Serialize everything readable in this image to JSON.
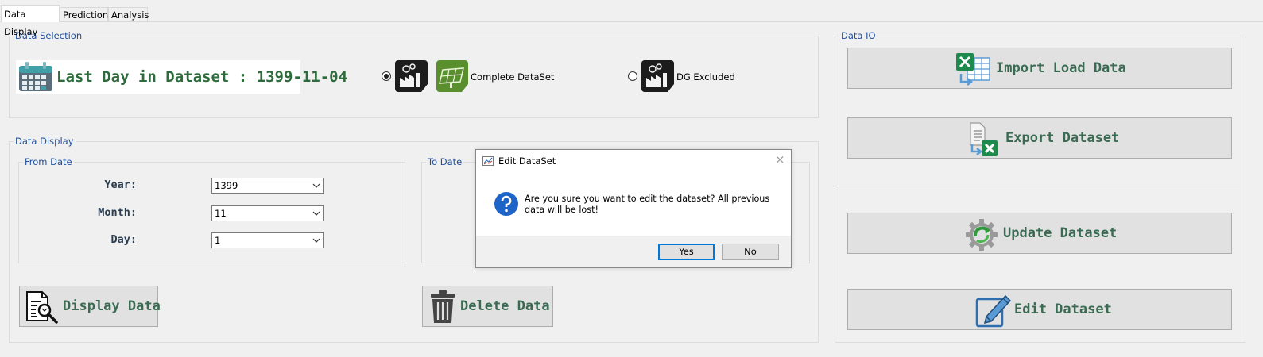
{
  "tabs": [
    {
      "label": "Data Display",
      "active": true
    },
    {
      "label": "Prediction",
      "active": false
    },
    {
      "label": "Analysis",
      "active": false
    }
  ],
  "data_selection": {
    "title": "Data Selection",
    "last_day_label": "Last Day in Dataset : 1399-11-04",
    "options": [
      {
        "label": "Complete DataSet",
        "selected": true
      },
      {
        "label": "DG Excluded",
        "selected": false
      }
    ]
  },
  "data_display": {
    "title": "Data Display",
    "from_date": {
      "title": "From Date",
      "year_label": "Year:",
      "year_value": "1399",
      "month_label": "Month:",
      "month_value": "11",
      "day_label": "Day:",
      "day_value": "1"
    },
    "to_date": {
      "title": "To Date"
    },
    "display_button": "Display Data",
    "delete_button": "Delete Data"
  },
  "data_io": {
    "title": "Data IO",
    "import_button": "Import Load Data",
    "export_button": "Export Dataset",
    "update_button": "Update Dataset",
    "edit_button": "Edit Dataset"
  },
  "dialog": {
    "title": "Edit DataSet",
    "message": "Are you sure you want to edit the dataset? All previous data will be lost!",
    "yes": "Yes",
    "no": "No",
    "close_glyph": "×"
  },
  "colors": {
    "legend": "#1f4e9c",
    "big_text": "#2e6b3c",
    "button_text": "#3a6b52",
    "excel_green": "#1d8a4b"
  }
}
